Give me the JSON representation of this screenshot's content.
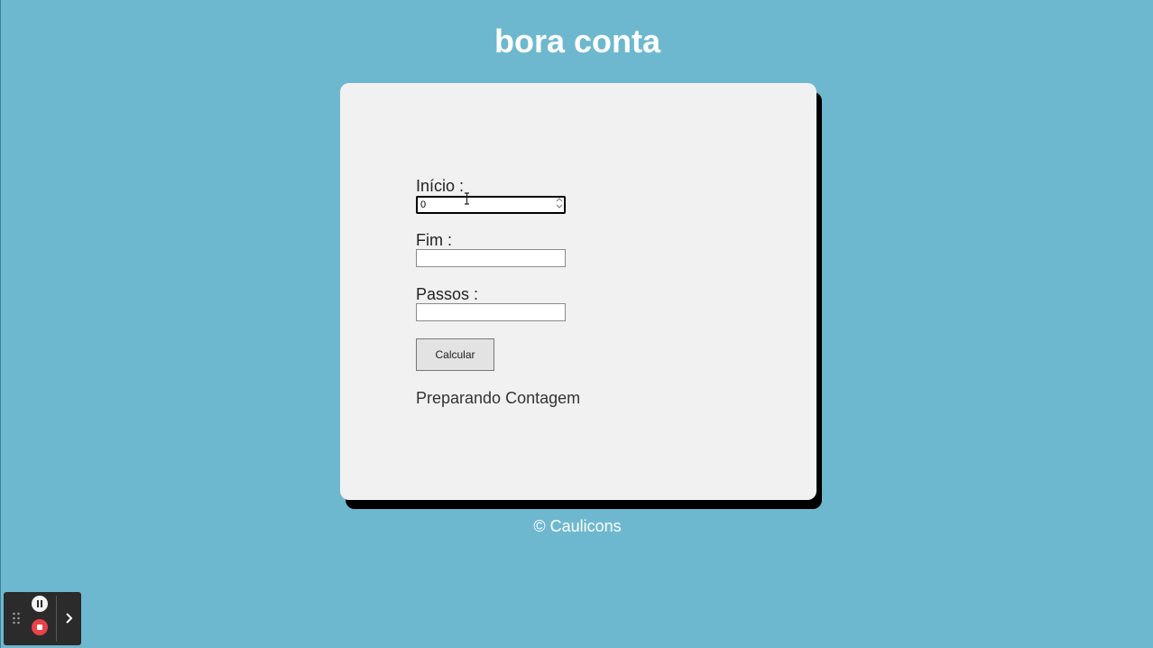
{
  "header": {
    "title": "bora conta"
  },
  "form": {
    "inicio": {
      "label": "Início :",
      "value": "0"
    },
    "fim": {
      "label": "Fim :",
      "value": ""
    },
    "passos": {
      "label": "Passos :",
      "value": ""
    },
    "calculate_label": "Calcular",
    "status": "Preparando Contagem"
  },
  "footer": {
    "text": "© Caulicons"
  },
  "recorder": {
    "icons": [
      "grip-icon",
      "pause-icon",
      "stop-icon",
      "chevron-right-icon"
    ]
  },
  "colors": {
    "background": "#6eb8cf",
    "card": "#f1f1f1",
    "card_shadow": "#000000",
    "stop_button": "#e8424a"
  }
}
